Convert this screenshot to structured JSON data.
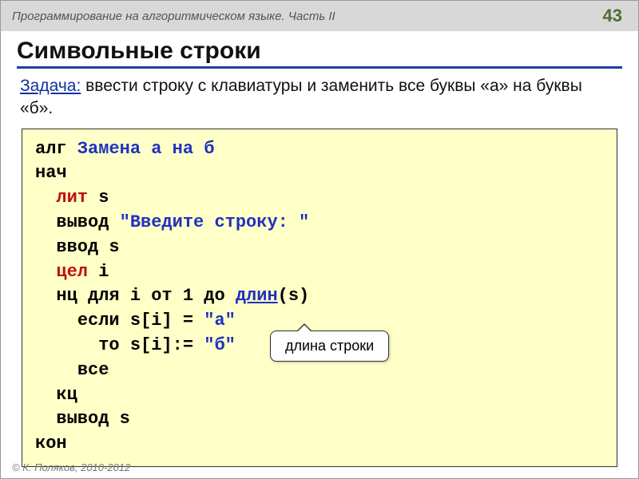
{
  "header": {
    "title": "Программирование на алгоритмическом языке. Часть II",
    "page": "43"
  },
  "heading": "Символьные строки",
  "task": {
    "label": "Задача:",
    "text": " ввести строку с клавиатуры и заменить все буквы «а» на буквы «б»."
  },
  "code": {
    "l1a": "алг ",
    "l1b": "Замена а на б",
    "l2": "нач",
    "l3a": "лит",
    "l3b": " s",
    "l4a": "вывод ",
    "l4b": "\"Введите строку: \"",
    "l5": "ввод s",
    "l6a": "цел",
    "l6b": " i",
    "l7a": "нц для i от 1 до ",
    "l7b": "длин",
    "l7c": "(s)",
    "l8a": "если s[i] = ",
    "l8b": "\"а\"",
    "l9a": "то s[i]:= ",
    "l9b": "\"б\"",
    "l10": "все",
    "l11": "кц",
    "l12": "вывод s",
    "l13": "кон"
  },
  "callout": "длина строки",
  "footer": "© К. Поляков, 2010-2012"
}
